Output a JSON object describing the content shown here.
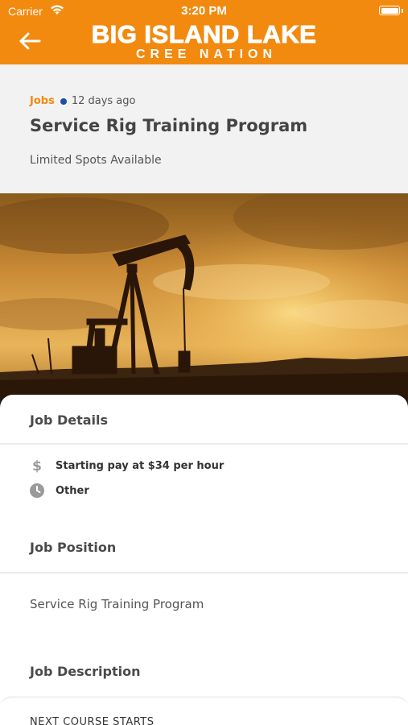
{
  "status_bar": {
    "carrier": "Carrier",
    "time": "3:20 PM"
  },
  "header": {
    "logo_main": "BIG ISLAND LAKE",
    "logo_sub": "CREE NATION",
    "brand_color": "#f28a0f"
  },
  "post": {
    "category": "Jobs",
    "posted": "12 days ago",
    "title": "Service Rig Training Program",
    "subtitle": "Limited Spots Available"
  },
  "hero": {
    "image_icon": "oil-pumpjack-sunset-photo"
  },
  "job_details": {
    "heading": "Job Details",
    "items": [
      {
        "icon": "dollar-icon",
        "text": "Starting pay at $34 per hour"
      },
      {
        "icon": "clock-icon",
        "text": "Other"
      }
    ]
  },
  "job_position": {
    "heading": "Job Position",
    "value": "Service Rig Training Program"
  },
  "job_description": {
    "heading": "Job Description",
    "preview": "NEXT COURSE STARTS"
  }
}
